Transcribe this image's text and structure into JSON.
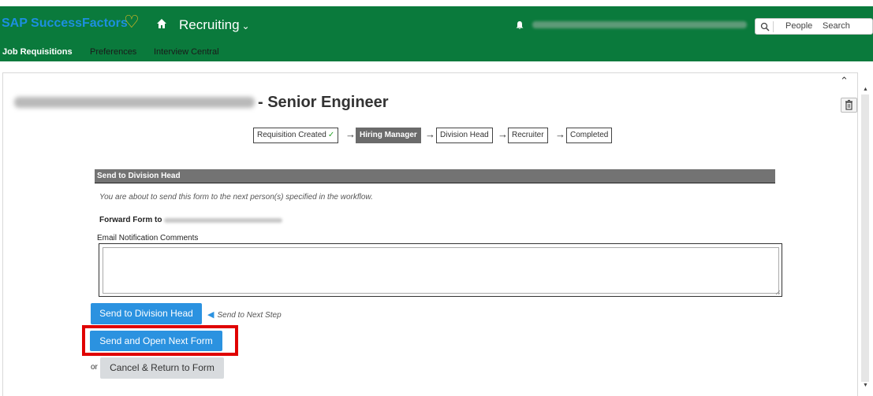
{
  "header": {
    "brand": "SAP SuccessFactors",
    "module": "Recruiting",
    "search": {
      "scope": "People",
      "placeholder": "Search"
    },
    "subnav": [
      {
        "label": "Job Requisitions",
        "active": true
      },
      {
        "label": "Preferences",
        "active": false
      },
      {
        "label": "Interview Central",
        "active": false
      }
    ]
  },
  "page": {
    "title_suffix": "- Senior Engineer"
  },
  "workflow": {
    "steps": [
      {
        "label": "Requisition Created",
        "done": true
      },
      {
        "label": "Hiring Manager",
        "current": true
      },
      {
        "label": "Division Head"
      },
      {
        "label": "Recruiter"
      },
      {
        "label": "Completed"
      }
    ]
  },
  "form": {
    "section_title": "Send to Division Head",
    "note": "You are about to send this form to the next person(s) specified in the workflow.",
    "forward_label": "Forward Form to",
    "email_label": "Email Notification Comments",
    "email_value": ""
  },
  "actions": {
    "send_label": "Send to Division Head",
    "next_step_hint": "Send to Next Step",
    "send_open_label": "Send and Open Next Form",
    "or_label": "or",
    "cancel_label": "Cancel & Return to Form"
  },
  "colors": {
    "header_bg": "#0a7a3c",
    "primary_button": "#2b92e0",
    "highlight": "#e00000"
  }
}
